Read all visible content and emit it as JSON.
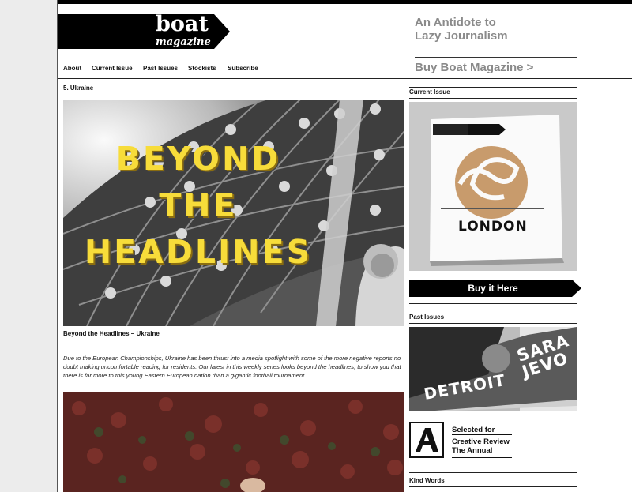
{
  "site": {
    "logo_word": "boat",
    "logo_sub": "magazine",
    "tagline": [
      "An Antidote to",
      "Lazy Journalism"
    ],
    "buy_link": "Buy Boat Magazine >"
  },
  "nav": {
    "items": [
      "About",
      "Current Issue",
      "Past Issues",
      "Stockists",
      "Subscribe"
    ]
  },
  "main": {
    "section_heading": "5. Ukraine",
    "hero_lines": [
      "BEYOND",
      "THE",
      "HEADLINES"
    ],
    "caption": "Beyond the Headlines – Ukraine",
    "article_text": "Due to the European Championships, Ukraine has been thrust into a media spotlight with some of the more negative reports no doubt making uncomfortable reading for residents. Our latest in this weekly series looks beyond the headlines, to show you that there is far more to this young Eastern European nation than a gigantic football tournament."
  },
  "sidebar": {
    "current_issue_heading": "Current Issue",
    "current_issue_title": "LONDON",
    "buy_button": "Buy it Here",
    "past_issues_heading": "Past Issues",
    "past_issue_covers": [
      "SARA JEVO",
      "DETROIT"
    ],
    "award": {
      "line1": "Selected for",
      "line2": "Creative Review",
      "line3": "The Annual"
    },
    "kind_words_heading": "Kind Words"
  },
  "colors": {
    "accent_yellow": "#f7dc3a",
    "banner": "#000000",
    "muted_text": "#8a8a8a"
  }
}
